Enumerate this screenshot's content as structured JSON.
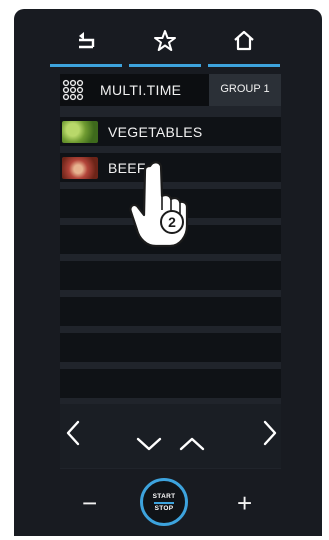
{
  "topbar": {
    "items": [
      {
        "icon": "back-icon"
      },
      {
        "icon": "star-icon"
      },
      {
        "icon": "home-icon"
      }
    ]
  },
  "list": {
    "header": {
      "icon": "grid-icon",
      "label": "MULTI.TIME",
      "group_label": "GROUP 1"
    },
    "rows": [
      {
        "label": "VEGETABLES",
        "thumb": "vegetables-thumb"
      },
      {
        "label": "BEEF",
        "thumb": "beef-thumb"
      }
    ]
  },
  "navigation": {
    "icons": [
      "chevron-left-icon",
      "chevron-down-icon",
      "chevron-up-icon",
      "chevron-right-icon"
    ]
  },
  "controls": {
    "minus_label": "−",
    "plus_label": "+",
    "start_label": "START",
    "stop_label": "STOP"
  },
  "callout": {
    "step_number": "2"
  },
  "colors": {
    "accent": "#3da3dd",
    "background": "#181b21",
    "row": "#0f1216"
  }
}
